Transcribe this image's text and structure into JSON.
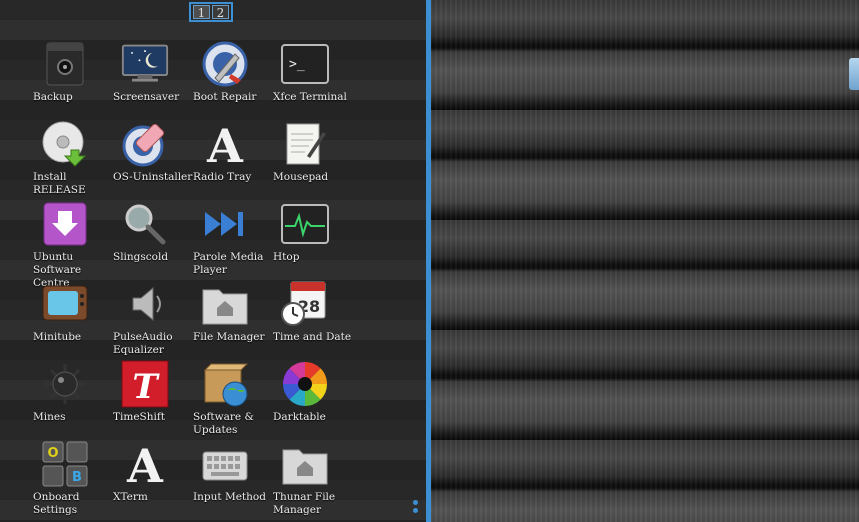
{
  "pager": {
    "pages": [
      "1",
      "2"
    ],
    "active": 0
  },
  "apps": [
    {
      "label": "Backup",
      "icon": "backup-icon"
    },
    {
      "label": "Screensaver",
      "icon": "screensaver-icon"
    },
    {
      "label": "Boot Repair",
      "icon": "boot-repair-icon"
    },
    {
      "label": "Xfce Terminal",
      "icon": "terminal-icon"
    },
    {
      "label": "Install RELEASE",
      "icon": "install-disc-icon"
    },
    {
      "label": "OS-Uninstaller",
      "icon": "os-uninstaller-icon"
    },
    {
      "label": "Radio Tray",
      "icon": "radio-tray-icon"
    },
    {
      "label": "Mousepad",
      "icon": "mousepad-icon"
    },
    {
      "label": "Ubuntu Software Centre",
      "icon": "software-centre-icon"
    },
    {
      "label": "Slingscold",
      "icon": "magnifier-icon"
    },
    {
      "label": "Parole Media Player",
      "icon": "media-player-icon"
    },
    {
      "label": "Htop",
      "icon": "htop-icon"
    },
    {
      "label": "Minitube",
      "icon": "tv-icon"
    },
    {
      "label": "PulseAudio Equalizer",
      "icon": "speaker-icon"
    },
    {
      "label": "File Manager",
      "icon": "folder-home-icon"
    },
    {
      "label": "Time and Date",
      "icon": "calendar-clock-icon"
    },
    {
      "label": "Mines",
      "icon": "mine-icon"
    },
    {
      "label": "TimeShift",
      "icon": "timeshift-icon"
    },
    {
      "label": "Software & Updates",
      "icon": "software-updates-icon"
    },
    {
      "label": "Darktable",
      "icon": "darktable-icon"
    },
    {
      "label": "Onboard Settings",
      "icon": "onboard-keyboard-icon"
    },
    {
      "label": "XTerm",
      "icon": "xterm-icon"
    },
    {
      "label": "Input Method",
      "icon": "keyboard-icon"
    },
    {
      "label": "Thunar File Manager",
      "icon": "folder-home-icon"
    }
  ],
  "icon_glyphs": {
    "radio_a": "A",
    "xterm_a": "A",
    "timeshift_t": "T",
    "onboard_o": "O",
    "onboard_b": "B",
    "calendar_num": "28",
    "terminal_prompt": ">_"
  }
}
